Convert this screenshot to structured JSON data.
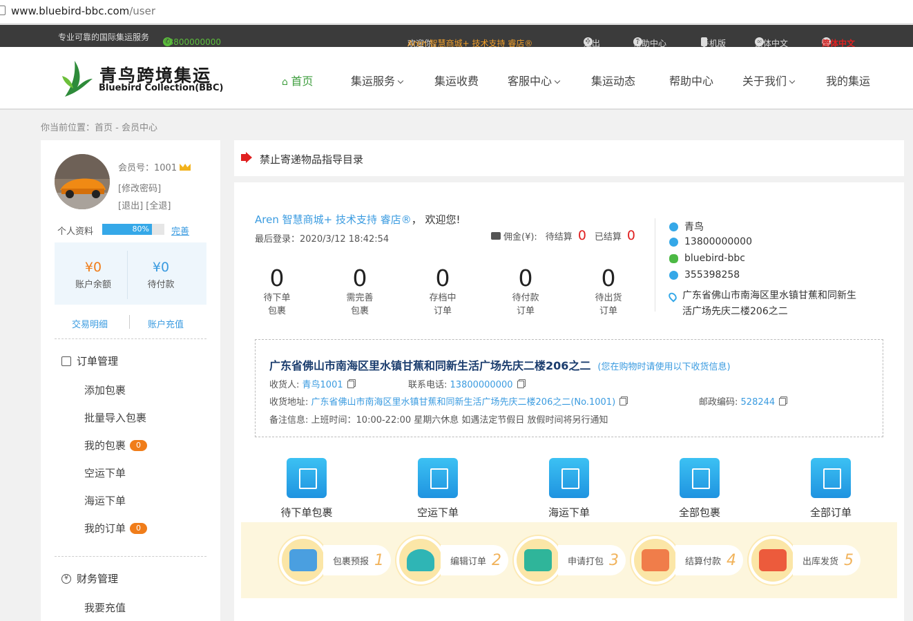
{
  "browser": {
    "url_domain": "www.bluebird-bbc.com",
    "url_path": "/user"
  },
  "topbar": {
    "slogan": "专业可靠的国际集运服务",
    "phone": "13800000000",
    "welcome_prefix": "欢迎你，",
    "welcome_user": "Aren 智慧商城+ 技术支持 睿店®",
    "links": [
      "退出",
      "帮助中心",
      "手机版",
      "繁体中文",
      "简体中文"
    ]
  },
  "logo": {
    "cn": "青鸟跨境集运",
    "en": "Bluebird Collection(BBC)"
  },
  "nav": [
    "首页",
    "集运服务",
    "集运收费",
    "客服中心",
    "集运动态",
    "帮助中心",
    "关于我们",
    "我的集运"
  ],
  "breadcrumb": "你当前位置：首页 - 会员中心",
  "sidebar": {
    "member_no": "会员号：1001",
    "change_password": "[修改密码]",
    "logout": "[退出] [全退]",
    "profile_label": "个人资料",
    "profile_percent": "80%",
    "profile_progress": 0.8,
    "complete": "完善",
    "balance": {
      "value": "¥0",
      "label": "账户余额"
    },
    "pending": {
      "value": "¥0",
      "label": "待付款"
    },
    "transactions": "交易明细",
    "recharge": "账户充值",
    "order_section": "订单管理",
    "order_items": [
      {
        "label": "添加包裹",
        "badge": ""
      },
      {
        "label": "批量导入包裹",
        "badge": ""
      },
      {
        "label": "我的包裹",
        "badge": "0"
      },
      {
        "label": "空运下单",
        "badge": ""
      },
      {
        "label": "海运下单",
        "badge": ""
      },
      {
        "label": "我的订单",
        "badge": "0"
      }
    ],
    "finance_section": "财务管理",
    "finance_items": [
      "我要充值"
    ]
  },
  "notice": "禁止寄递物品指导目录",
  "main": {
    "greet_name": "Aren 智慧商城+ 技术支持 睿店®",
    "greet_suffix": "，  欢迎您!",
    "last_login": "最后登录：2020/3/12 18:42:54",
    "commission_label": "佣金(¥):",
    "to_settle_label": "待结算",
    "to_settle": "0",
    "settled_label": "已结算",
    "settled": "0",
    "stats": [
      {
        "n": "0",
        "l1": "待下单",
        "l2": "包裹"
      },
      {
        "n": "0",
        "l1": "需完善",
        "l2": "包裹"
      },
      {
        "n": "0",
        "l1": "存档中",
        "l2": "订单"
      },
      {
        "n": "0",
        "l1": "待付款",
        "l2": "订单"
      },
      {
        "n": "0",
        "l1": "待出货",
        "l2": "订单"
      }
    ],
    "contact": {
      "name": "青鸟",
      "phone": "13800000000",
      "wechat": "bluebird-bbc",
      "qq": "355398258",
      "address": "广东省佛山市南海区里水镇甘蕉和同新生活广场先庆二楼206之二"
    },
    "address_box": {
      "title": "广东省佛山市南海区里水镇甘蕉和同新生活广场先庆二楼206之二",
      "tip": "(您在购物时请使用以下收货信息)",
      "receiver_label": "收货人:",
      "receiver": "青鸟1001",
      "phone_label": "联系电话:",
      "phone": "13800000000",
      "address_label": "收货地址:",
      "address": "广东省佛山市南海区里水镇甘蕉和同新生活广场先庆二楼206之二(No.1001)",
      "zip_label": "邮政编码:",
      "zip": "528244",
      "note_label": "备注信息:",
      "note": "上班时间：10:00-22:00 星期六休息 如遇法定节假日 放假时间将另行通知"
    },
    "quick_actions": [
      "待下单包裹",
      "空运下单",
      "海运下单",
      "全部包裹",
      "全部订单"
    ],
    "steps": [
      {
        "label": "包裹预报",
        "no": "1"
      },
      {
        "label": "编辑订单",
        "no": "2"
      },
      {
        "label": "申请打包",
        "no": "3"
      },
      {
        "label": "结算付款",
        "no": "4"
      },
      {
        "label": "出库发货",
        "no": "5"
      }
    ]
  }
}
